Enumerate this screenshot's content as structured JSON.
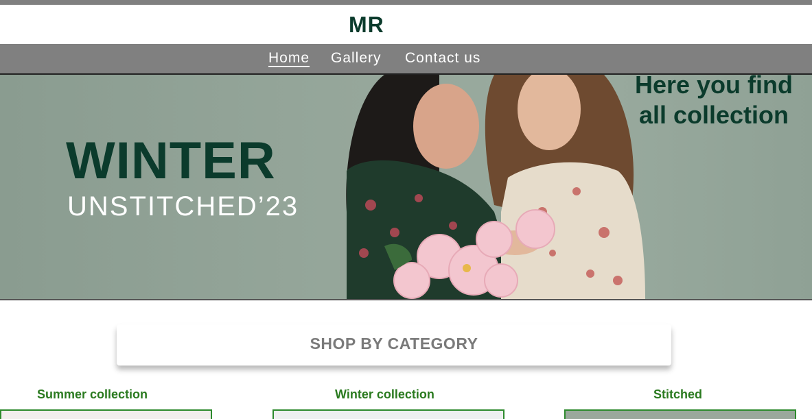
{
  "header": {
    "brand": "MR"
  },
  "nav": {
    "items": [
      {
        "label": "Home"
      },
      {
        "label": "Gallery"
      },
      {
        "label": "Contact us"
      }
    ]
  },
  "hero": {
    "headline": "WINTER",
    "subheadline": "UNSTITCHED’23",
    "tagline_line1": "Here you find",
    "tagline_line2": "all collection"
  },
  "section": {
    "title": "SHOP BY CATEGORY"
  },
  "categories": [
    {
      "label": "Summer collection"
    },
    {
      "label": "Winter collection"
    },
    {
      "label": "Stitched"
    }
  ],
  "colors": {
    "brand": "#0b3b2c",
    "nav_bg": "#808080",
    "category": "#2a7a1f",
    "accent_border": "#2d8a2d"
  }
}
